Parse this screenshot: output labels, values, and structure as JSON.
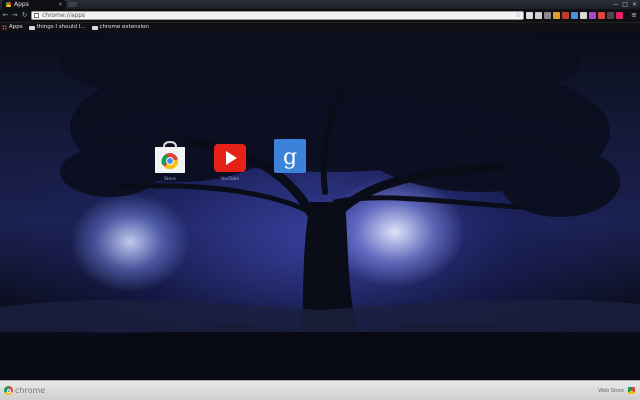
{
  "tab": {
    "title": "Apps",
    "close": "×"
  },
  "window_controls": [
    "−",
    "□",
    "×"
  ],
  "toolbar": {
    "back": "←",
    "forward": "→",
    "reload": "↻",
    "url": "chrome://apps",
    "star": "☆",
    "menu": "≡"
  },
  "extensions": [
    "#dddddd",
    "#cfcfcf",
    "#888888",
    "#e0a030",
    "#c0392b",
    "#4a90d9",
    "#d9d9d9",
    "#a64ac9",
    "#e0443e",
    "#4a4a4a",
    "#e91e63"
  ],
  "bookmarks": {
    "apps_label": "Apps",
    "items": [
      {
        "label": "things I should l..."
      },
      {
        "label": "chrome extension"
      }
    ]
  },
  "apps": [
    {
      "name": "Store",
      "icon": "webstore-icon"
    },
    {
      "name": "YouTube",
      "icon": "youtube-icon"
    },
    {
      "name": "",
      "icon": "google-search-icon"
    }
  ],
  "bottombar": {
    "brand": "chrome",
    "webstore_label": "Web Store"
  }
}
